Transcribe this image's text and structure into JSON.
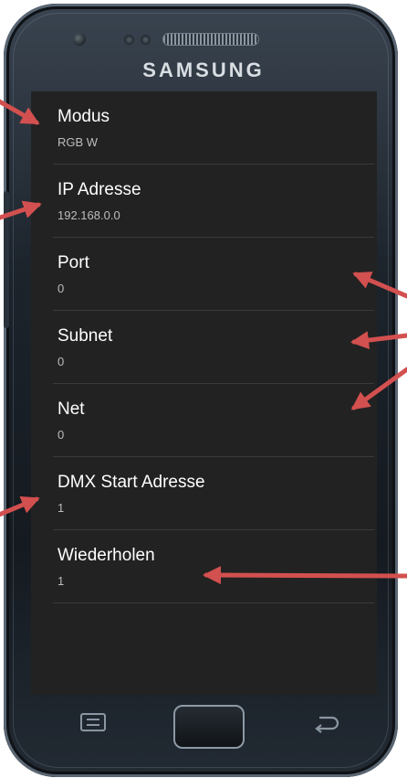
{
  "device": {
    "brand": "SAMSUNG"
  },
  "settings": {
    "items": [
      {
        "title": "Modus",
        "summary": "RGB W"
      },
      {
        "title": "IP Adresse",
        "summary": "192.168.0.0"
      },
      {
        "title": "Port",
        "summary": "0"
      },
      {
        "title": "Subnet",
        "summary": "0"
      },
      {
        "title": "Net",
        "summary": "0"
      },
      {
        "title": "DMX Start Adresse",
        "summary": "1"
      },
      {
        "title": "Wiederholen",
        "summary": "1"
      }
    ]
  },
  "colors": {
    "screen_background": "#222222",
    "title_text": "#ffffff",
    "summary_text": "#bdbdbd",
    "divider": "#3a3a3a",
    "annotation_arrow": "#d2504f"
  },
  "icons": {
    "menu_key": "menu-icon",
    "home_key": "home-button",
    "back_key": "back-arrow-icon"
  }
}
